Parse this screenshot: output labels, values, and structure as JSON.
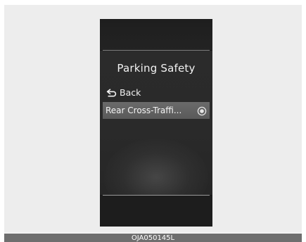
{
  "screen": {
    "title": "Parking Safety",
    "back_label": "Back",
    "selected_item": {
      "label": "Rear Cross-Traffi...",
      "radio_selected": true
    }
  },
  "caption": {
    "code": "OJA050145L"
  },
  "icons": {
    "back": "back-arrow-icon",
    "radio": "radio-selected-icon"
  },
  "colors": {
    "screen_bg": "#2a2a2a",
    "highlight_row": "#626262",
    "text": "#f2f2f2",
    "caption_bar": "#6e6e6e"
  }
}
